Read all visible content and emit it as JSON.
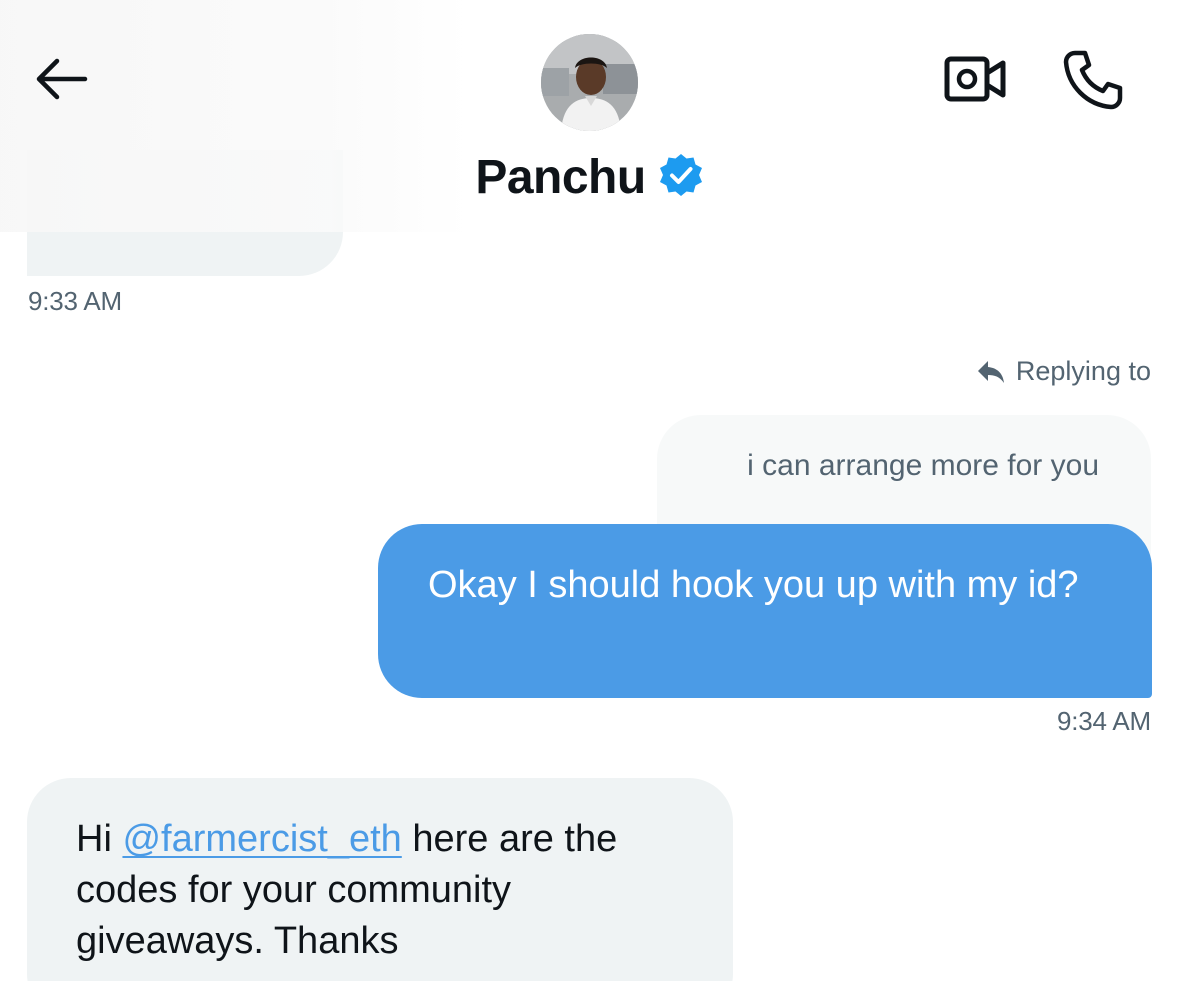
{
  "header": {
    "contact_name": "Panchu",
    "verified": true,
    "back_icon": "arrow-left-icon",
    "video_icon": "video-camera-icon",
    "phone_icon": "phone-icon",
    "verified_icon": "verified-badge-icon"
  },
  "messages": {
    "first_timestamp": "9:33 AM",
    "reply_context": {
      "label": "Replying to",
      "icon": "reply-arrow-icon",
      "quoted_text": "i can arrange more for you"
    },
    "sent": {
      "text": "Okay I should hook you up with my id?",
      "timestamp": "9:34 AM"
    },
    "received": {
      "prefix": "Hi ",
      "mention": "@farmercist_eth",
      "suffix": " here are the codes for your community giveaways.  Thanks"
    }
  },
  "colors": {
    "accent_blue": "#4b9be6",
    "received_bubble": "#eff3f4",
    "muted_text": "#536471",
    "primary_text": "#0f1419"
  }
}
